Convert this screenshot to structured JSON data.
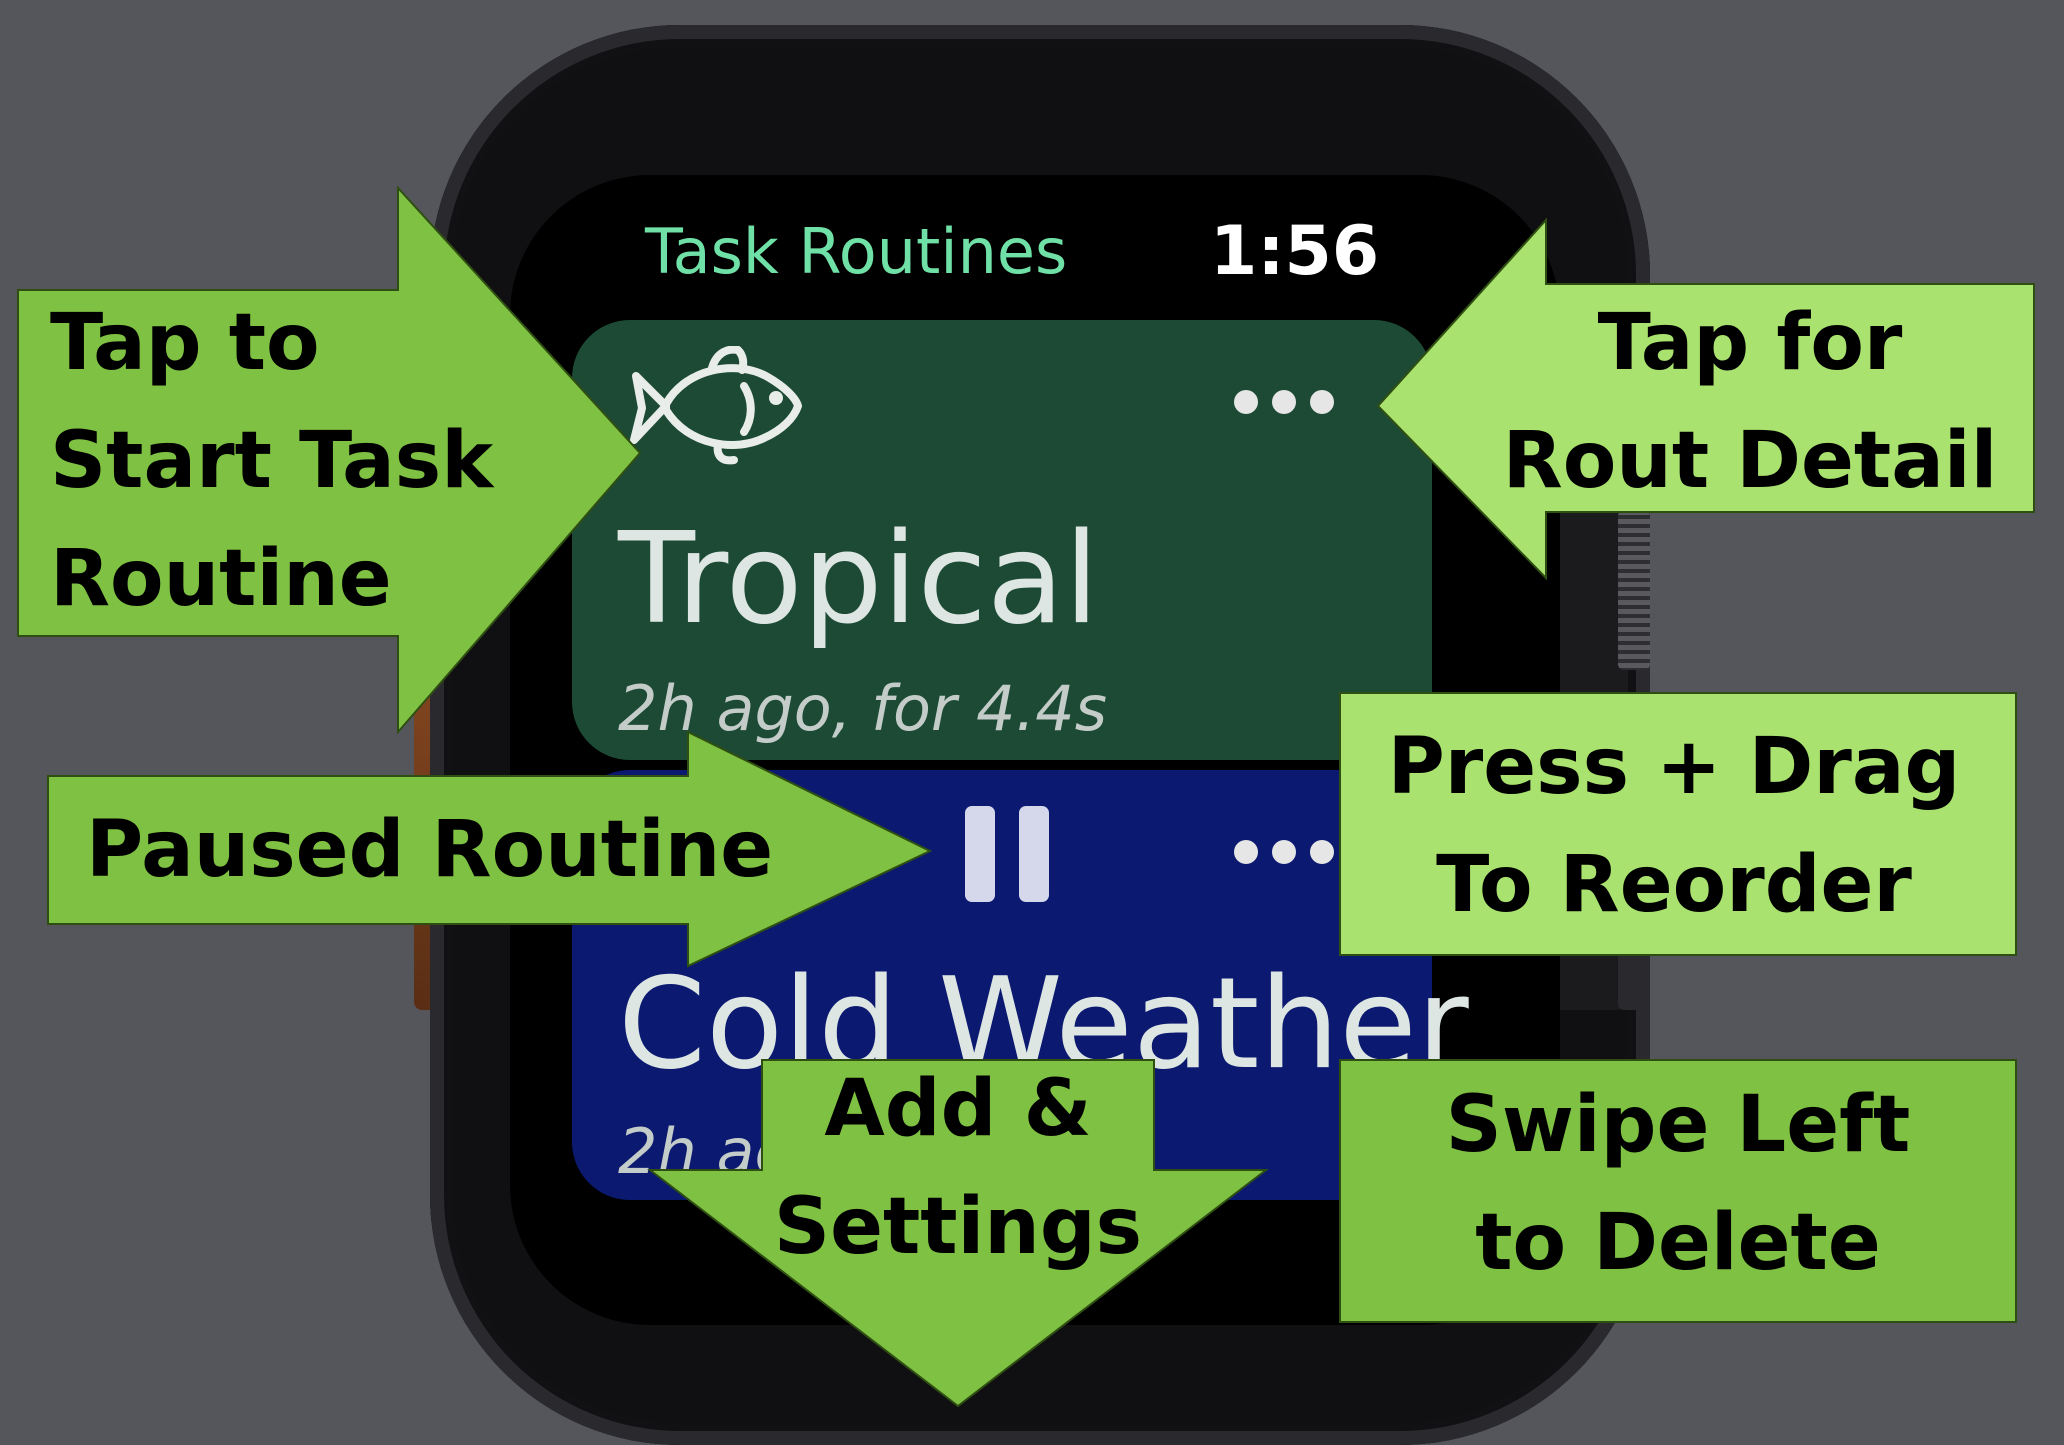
{
  "watch": {
    "app_title": "Task Routines",
    "time": "1:56",
    "routines": [
      {
        "name": "Tropical",
        "subtitle": "2h ago, for 4.4s",
        "icon": "fish-icon",
        "color": "#1c4a34"
      },
      {
        "name": "Cold Weather",
        "subtitle": "2h ag",
        "icon": "pause-icon",
        "color": "#0b1a70"
      }
    ]
  },
  "annotations": {
    "tap_start": [
      "Tap to",
      "Start Task",
      "Routine"
    ],
    "paused": "Paused Routine",
    "tap_detail": [
      "Tap for",
      "Rout Detail"
    ],
    "reorder": [
      "Press + Drag",
      "To Reorder"
    ],
    "add_settings": [
      "Add &",
      "Settings"
    ],
    "swipe_delete": [
      "Swipe Left",
      "to Delete"
    ]
  },
  "colors": {
    "background": "#55565c",
    "callout_green": "#7fc142",
    "callout_light_green": "#a9e26e",
    "title_green": "#6fe0a6"
  }
}
